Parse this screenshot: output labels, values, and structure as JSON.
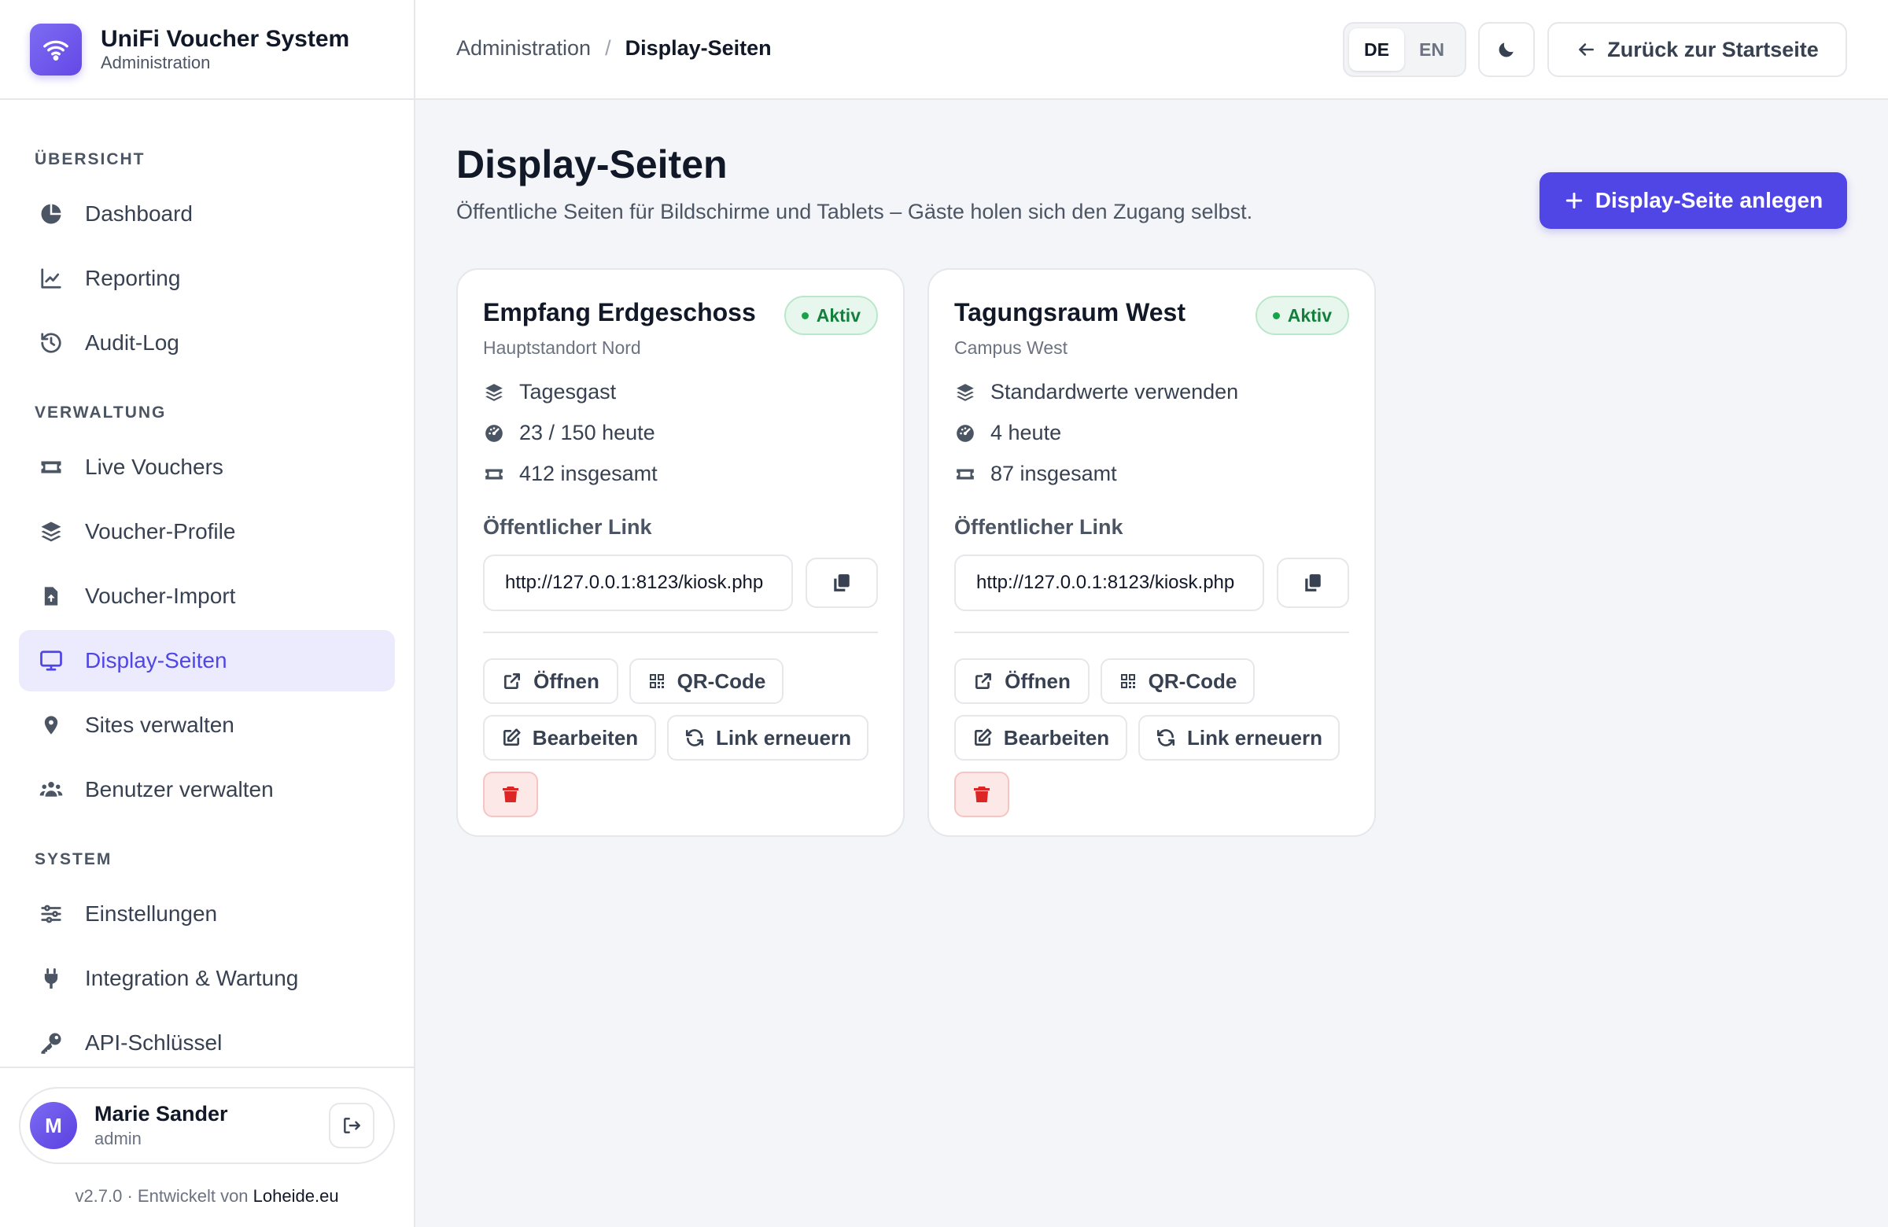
{
  "brand": {
    "title": "UniFi Voucher System",
    "subtitle": "Administration"
  },
  "sidebar": {
    "sections": [
      {
        "title": "ÜBERSICHT",
        "items": [
          {
            "label": "Dashboard",
            "icon": "pie-chart-icon"
          },
          {
            "label": "Reporting",
            "icon": "line-chart-icon"
          },
          {
            "label": "Audit-Log",
            "icon": "history-icon"
          }
        ]
      },
      {
        "title": "VERWALTUNG",
        "items": [
          {
            "label": "Live Vouchers",
            "icon": "ticket-icon"
          },
          {
            "label": "Voucher-Profile",
            "icon": "layers-icon"
          },
          {
            "label": "Voucher-Import",
            "icon": "file-upload-icon"
          },
          {
            "label": "Display-Seiten",
            "icon": "monitor-icon",
            "active": true
          },
          {
            "label": "Sites verwalten",
            "icon": "map-pin-icon"
          },
          {
            "label": "Benutzer verwalten",
            "icon": "users-icon"
          }
        ]
      },
      {
        "title": "SYSTEM",
        "items": [
          {
            "label": "Einstellungen",
            "icon": "sliders-icon"
          },
          {
            "label": "Integration & Wartung",
            "icon": "plug-icon"
          },
          {
            "label": "API-Schlüssel",
            "icon": "key-icon"
          }
        ]
      }
    ],
    "user": {
      "initial": "M",
      "name": "Marie Sander",
      "role": "admin"
    },
    "version": "v2.7.0 · Entwickelt von",
    "developer": "Loheide.eu"
  },
  "topbar": {
    "breadcrumb_root": "Administration",
    "breadcrumb_sep": "/",
    "breadcrumb_current": "Display-Seiten",
    "lang_de": "DE",
    "lang_en": "EN",
    "back_label": "Zurück zur Startseite"
  },
  "main": {
    "title": "Display-Seiten",
    "subtitle": "Öffentliche Seiten für Bildschirme und Tablets – Gäste holen sich den Zugang selbst.",
    "create_label": "Display-Seite anlegen",
    "cards": [
      {
        "title": "Empfang Erdgeschoss",
        "location": "Hauptstandort Nord",
        "status": "Aktiv",
        "profile": "Tagesgast",
        "today": "23 / 150 heute",
        "total": "412 insgesamt",
        "link_label": "Öffentlicher Link",
        "link": "http://127.0.0.1:8123/kiosk.php",
        "open_label": "Öffnen",
        "qr_label": "QR-Code",
        "edit_label": "Bearbeiten",
        "renew_label": "Link erneuern"
      },
      {
        "title": "Tagungsraum West",
        "location": "Campus West",
        "status": "Aktiv",
        "profile": "Standardwerte verwenden",
        "today": "4 heute",
        "total": "87 insgesamt",
        "link_label": "Öffentlicher Link",
        "link": "http://127.0.0.1:8123/kiosk.php",
        "open_label": "Öffnen",
        "qr_label": "QR-Code",
        "edit_label": "Bearbeiten",
        "renew_label": "Link erneuern"
      }
    ]
  },
  "colors": {
    "accent": "#5046e5",
    "active_bg": "#ecebfd",
    "success": "#15803d",
    "danger": "#dc2626"
  }
}
